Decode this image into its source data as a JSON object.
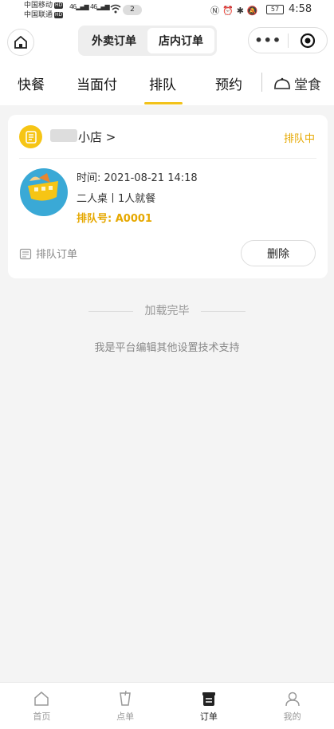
{
  "status_bar": {
    "carrier1": "中国移动",
    "carrier2": "中国联通",
    "hd": "HD",
    "signal1": "46",
    "signal2": "46",
    "notification_count": "2",
    "battery": "57",
    "time": "4:58"
  },
  "top_nav": {
    "segments": [
      "外卖订单",
      "店内订单"
    ],
    "active_segment": "店内订单",
    "more_icon": "more-dots-icon",
    "close_icon": "target-icon"
  },
  "tabs": {
    "items": [
      "快餐",
      "当面付",
      "排队",
      "预约"
    ],
    "active": "排队",
    "dine_in": "堂食",
    "accent": "#f2c21a"
  },
  "order": {
    "store_name": "小店",
    "store_arrow": ">",
    "status": "排队中",
    "time_label": "时间:",
    "time_value": "2021-08-21 14:18",
    "table_info": "二人桌丨1人就餐",
    "queue_label": "排队号:",
    "queue_number": "A0001",
    "order_type": "排队订单",
    "delete_label": "删除",
    "status_color": "#e6a800"
  },
  "list_footer": {
    "loaded_text": "加载完毕",
    "support_text": "我是平台编辑其他设置技术支持"
  },
  "bottom_bar": {
    "items": [
      {
        "label": "首页",
        "icon": "home-icon"
      },
      {
        "label": "点单",
        "icon": "cup-icon"
      },
      {
        "label": "订单",
        "icon": "order-icon"
      },
      {
        "label": "我的",
        "icon": "user-icon"
      }
    ],
    "active": "订单"
  }
}
